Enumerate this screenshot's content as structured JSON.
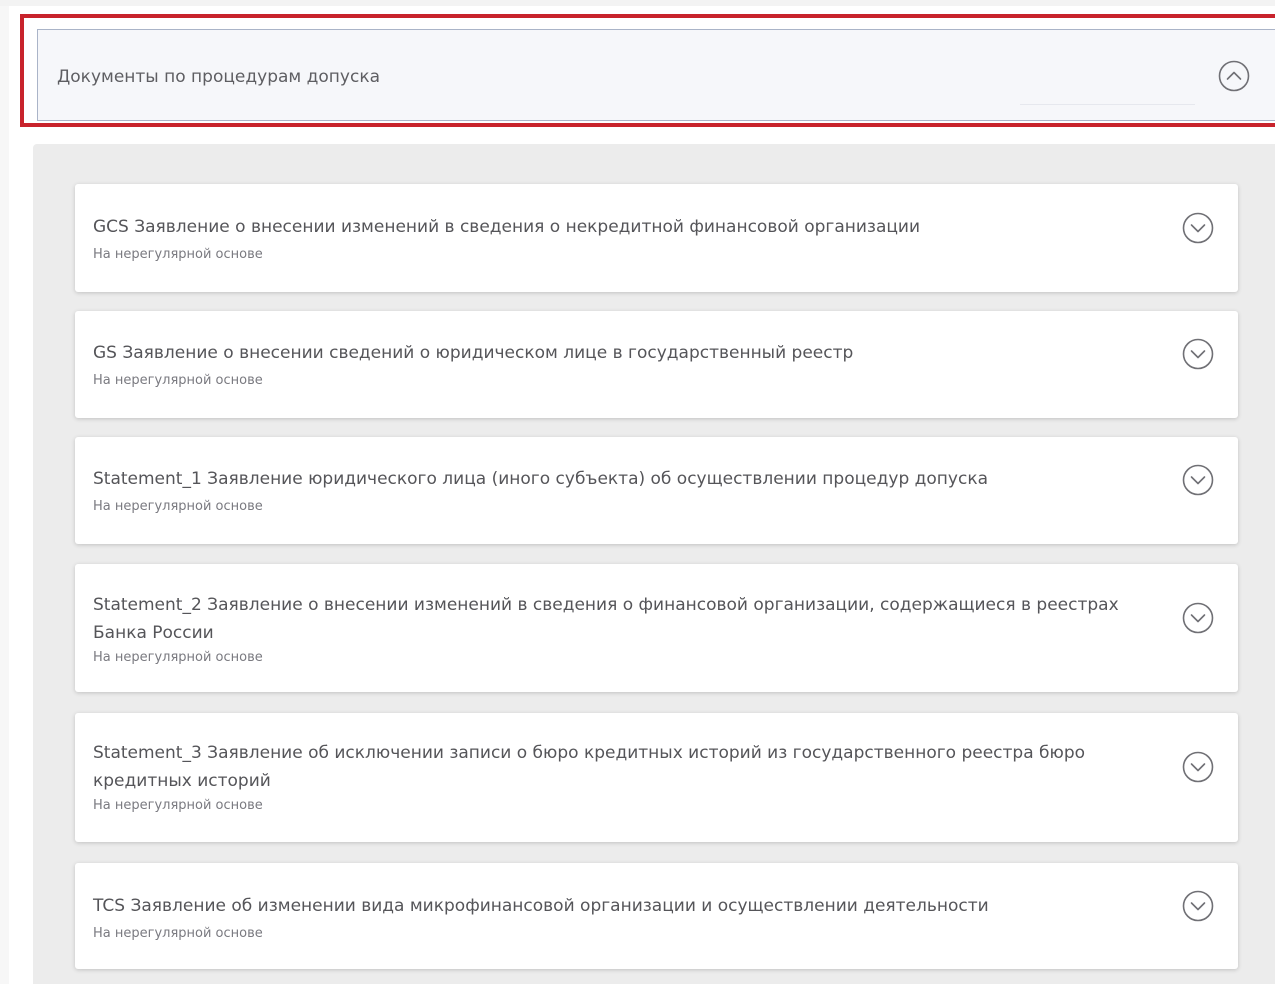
{
  "section": {
    "title": "Документы по процедурам допуска",
    "state_icon": "chevron-up-circle-icon"
  },
  "documents": [
    {
      "title": "GCS Заявление о внесении изменений в сведения о некредитной финансовой организации",
      "frequency": "На нерегулярной основе",
      "icon": "chevron-down-circle-icon"
    },
    {
      "title": "GS Заявление о внесении сведений о юридическом лице в государственный реестр",
      "frequency": "На нерегулярной основе",
      "icon": "chevron-down-circle-icon"
    },
    {
      "title": "Statement_1 Заявление юридического лица (иного субъекта) об осуществлении процедур допуска",
      "frequency": "На нерегулярной основе",
      "icon": "chevron-down-circle-icon"
    },
    {
      "title": "Statement_2 Заявление о внесении изменений в сведения о финансовой организации, содержащиеся в реестрах Банка России",
      "frequency": "На нерегулярной основе",
      "icon": "chevron-down-circle-icon"
    },
    {
      "title": "Statement_3 Заявление об исключении записи о бюро кредитных историй из государственного реестра бюро кредитных историй",
      "frequency": "На нерегулярной основе",
      "icon": "chevron-down-circle-icon"
    },
    {
      "title": "TCS Заявление об изменении вида микрофинансовой организации и осуществлении деятельности",
      "frequency": "На нерегулярной основе",
      "icon": "chevron-down-circle-icon"
    }
  ],
  "colors": {
    "highlight": "#c8232c",
    "header_bg": "#f6f7fa",
    "header_border": "#aab4c8",
    "panel_bg": "#ececec",
    "card_bg": "#ffffff",
    "text": "#555559",
    "subtext": "#7a7a80"
  }
}
